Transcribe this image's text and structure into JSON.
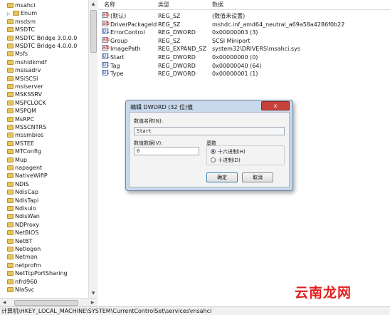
{
  "tree": {
    "items": [
      {
        "label": "msahci",
        "expander": false
      },
      {
        "label": "Enum",
        "expander": true
      },
      {
        "label": "msdsm",
        "expander": false
      },
      {
        "label": "MSDTC",
        "expander": false
      },
      {
        "label": "MSDTC Bridge 3.0.0.0",
        "expander": false
      },
      {
        "label": "MSDTC Bridge 4.0.0.0",
        "expander": false
      },
      {
        "label": "Msfs",
        "expander": false
      },
      {
        "label": "mshidkmdf",
        "expander": false
      },
      {
        "label": "msisadrv",
        "expander": false
      },
      {
        "label": "MSiSCSI",
        "expander": false
      },
      {
        "label": "msiserver",
        "expander": false
      },
      {
        "label": "MSKSSRV",
        "expander": false
      },
      {
        "label": "MSPCLOCK",
        "expander": false
      },
      {
        "label": "MSPQM",
        "expander": false
      },
      {
        "label": "MsRPC",
        "expander": false
      },
      {
        "label": "MSSCNTRS",
        "expander": false
      },
      {
        "label": "mssmbios",
        "expander": false
      },
      {
        "label": "MSTEE",
        "expander": false
      },
      {
        "label": "MTConfig",
        "expander": false
      },
      {
        "label": "Mup",
        "expander": false
      },
      {
        "label": "napagent",
        "expander": false
      },
      {
        "label": "NativeWifiP",
        "expander": false
      },
      {
        "label": "NDIS",
        "expander": false
      },
      {
        "label": "NdisCap",
        "expander": false
      },
      {
        "label": "NdisTapi",
        "expander": false
      },
      {
        "label": "Ndisuio",
        "expander": false
      },
      {
        "label": "NdisWan",
        "expander": false
      },
      {
        "label": "NDProxy",
        "expander": false
      },
      {
        "label": "NetBIOS",
        "expander": false
      },
      {
        "label": "NetBT",
        "expander": false
      },
      {
        "label": "Netlogon",
        "expander": false
      },
      {
        "label": "Netman",
        "expander": false
      },
      {
        "label": "netprofm",
        "expander": false
      },
      {
        "label": "NetTcpPortSharing",
        "expander": false
      },
      {
        "label": "nfrd960",
        "expander": false
      },
      {
        "label": "NlaSvc",
        "expander": false
      }
    ]
  },
  "list": {
    "headers": {
      "name": "名称",
      "type": "类型",
      "data": "数据"
    },
    "rows": [
      {
        "name": "(默认)",
        "type": "REG_SZ",
        "data": "(数值未设置)",
        "icon": "ab"
      },
      {
        "name": "DriverPackageId",
        "type": "REG_SZ",
        "data": "mshdc.inf_amd64_neutral_a69a58a4286f0b22",
        "icon": "ab"
      },
      {
        "name": "ErrorControl",
        "type": "REG_DWORD",
        "data": "0x00000003 (3)",
        "icon": "bin"
      },
      {
        "name": "Group",
        "type": "REG_SZ",
        "data": "SCSI Miniport",
        "icon": "ab"
      },
      {
        "name": "ImagePath",
        "type": "REG_EXPAND_SZ",
        "data": "system32\\DRIVERS\\msahci.sys",
        "icon": "ab"
      },
      {
        "name": "Start",
        "type": "REG_DWORD",
        "data": "0x00000000 (0)",
        "icon": "bin"
      },
      {
        "name": "Tag",
        "type": "REG_DWORD",
        "data": "0x00000040 (64)",
        "icon": "bin"
      },
      {
        "name": "Type",
        "type": "REG_DWORD",
        "data": "0x00000001 (1)",
        "icon": "bin"
      }
    ]
  },
  "dialog": {
    "title": "编辑 DWORD (32 位)值",
    "close_label": "x",
    "value_name_label": "数值名称(N):",
    "value_name": "Start",
    "value_data_label": "数值数据(V):",
    "value_data": "0",
    "base_label": "基数",
    "hex_label": "十六进制(H)",
    "dec_label": "十进制(D)",
    "ok_label": "确定",
    "cancel_label": "取消"
  },
  "status_bar": {
    "path": "计算机\\HKEY_LOCAL_MACHINE\\SYSTEM\\CurrentControlSet\\services\\msahci"
  },
  "watermark": {
    "text": "云南龙网"
  },
  "colors": {
    "watermark": "#e51d1d",
    "dialog_frame": "#c9d9ec",
    "close_button": "#c9403a"
  }
}
